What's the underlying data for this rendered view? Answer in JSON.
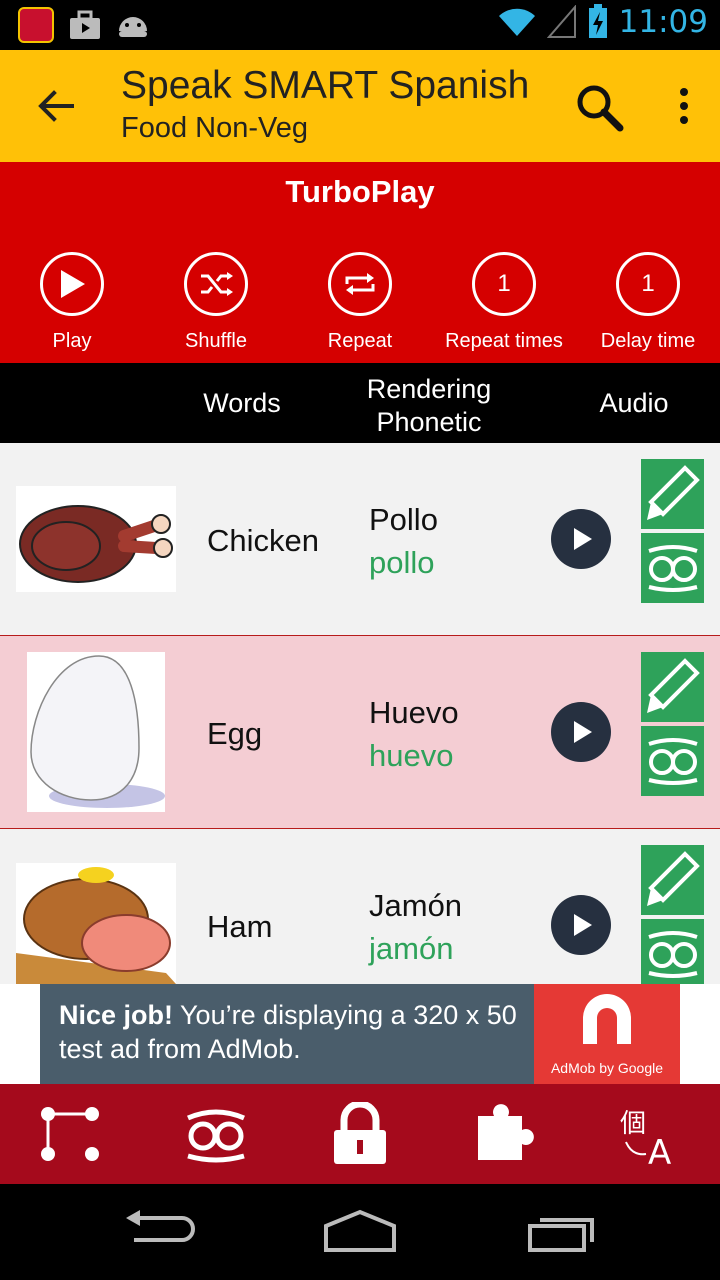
{
  "status_bar": {
    "time": "11:09",
    "icons": [
      "app-notification-icon",
      "briefcase-icon",
      "android-icon",
      "wifi-icon",
      "signal-icon",
      "battery-charging-icon"
    ],
    "time_color": "#33b5e5"
  },
  "app_bar": {
    "title": "Speak SMART Spanish",
    "subtitle": "Food Non-Veg",
    "background": "#ffc107",
    "icons": [
      "back-arrow-icon",
      "search-icon",
      "more-vert-icon"
    ]
  },
  "turboplay": {
    "title": "TurboPlay",
    "background": "#d50000",
    "controls": [
      {
        "label": "Play",
        "icon": "play-icon",
        "value": ""
      },
      {
        "label": "Shuffle",
        "icon": "shuffle-icon",
        "value": ""
      },
      {
        "label": "Repeat",
        "icon": "repeat-icon",
        "value": ""
      },
      {
        "label": "Repeat times",
        "icon": "",
        "value": "1"
      },
      {
        "label": "Delay time",
        "icon": "",
        "value": "1"
      }
    ]
  },
  "columns": {
    "words": "Words",
    "rendering": "Rendering",
    "phonetic": "Phonetic",
    "audio": "Audio"
  },
  "rows": [
    {
      "word": "Chicken",
      "translation": "Pollo",
      "phonetic": "pollo",
      "image": "roast-chicken-image"
    },
    {
      "word": "Egg",
      "translation": "Huevo",
      "phonetic": "huevo",
      "image": "egg-image"
    },
    {
      "word": "Ham",
      "translation": "Jamón",
      "phonetic": "jamón",
      "image": "ham-image"
    }
  ],
  "row_actions": [
    "pencil-icon",
    "owl-icon"
  ],
  "ad": {
    "bold": "Nice job!",
    "text": " You’re displaying a 320 x 50 test ad from AdMob.",
    "brand": "AdMob by Google"
  },
  "bottom_nav": [
    "connections-icon",
    "owl-icon",
    "lock-icon",
    "puzzle-icon",
    "translate-icon"
  ],
  "system_nav": [
    "back-icon",
    "home-icon",
    "recents-icon"
  ],
  "colors": {
    "accent_green": "#2ea25a",
    "row_alt": "#f4cdd3",
    "bottom_nav": "#a50a1c"
  }
}
